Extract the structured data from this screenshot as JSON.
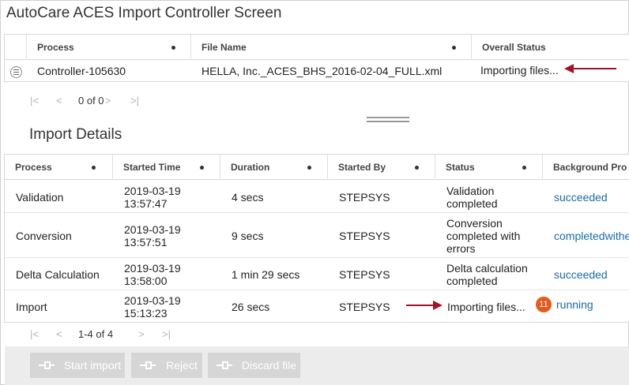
{
  "window": {
    "title": "AutoCare ACES Import Controller Screen"
  },
  "controller_grid": {
    "columns": [
      "Process",
      "File Name",
      "Overall Status"
    ],
    "row": {
      "process": "Controller-105630",
      "file_name": "HELLA, Inc._ACES_BHS_2016-02-04_FULL.xml",
      "overall_status": "Importing files..."
    }
  },
  "controller_pager": {
    "text": "0 of 0"
  },
  "import_details": {
    "title": "Import Details",
    "columns": [
      "Process",
      "Started Time",
      "Duration",
      "Started By",
      "Status",
      "Background Pro"
    ],
    "rows": [
      {
        "process": "Validation",
        "started_date": "2019-03-19",
        "started_time": "13:57:47",
        "duration": "4 secs",
        "started_by": "STEPSYS",
        "status": "Validation completed",
        "background": "succeeded"
      },
      {
        "process": "Conversion",
        "started_date": "2019-03-19",
        "started_time": "13:57:51",
        "duration": "9 secs",
        "started_by": "STEPSYS",
        "status": "Conversion completed with errors",
        "background": "completedwithe"
      },
      {
        "process": "Delta Calculation",
        "started_date": "2019-03-19",
        "started_time": "13:58:00",
        "duration": "1 min 29 secs",
        "started_by": "STEPSYS",
        "status": "Delta calculation completed",
        "background": "succeeded"
      },
      {
        "process": "Import",
        "started_date": "2019-03-19",
        "started_time": "15:13:23",
        "duration": "26 secs",
        "started_by": "STEPSYS",
        "status": "Importing files...",
        "background": "running",
        "badge": "11"
      }
    ],
    "pager": {
      "text": "1-4 of 4"
    }
  },
  "pager_icons": {
    "first": "|<",
    "prev": "<",
    "next": ">",
    "last": ">|"
  },
  "footer": {
    "start_import": "Start import",
    "reject": "Reject",
    "discard_file": "Discard file"
  },
  "colors": {
    "annotation_arrow": "#a3122a",
    "link": "#1a6aa8",
    "badge": "#e55a1c",
    "disabled_button": "#d6d6d6"
  }
}
